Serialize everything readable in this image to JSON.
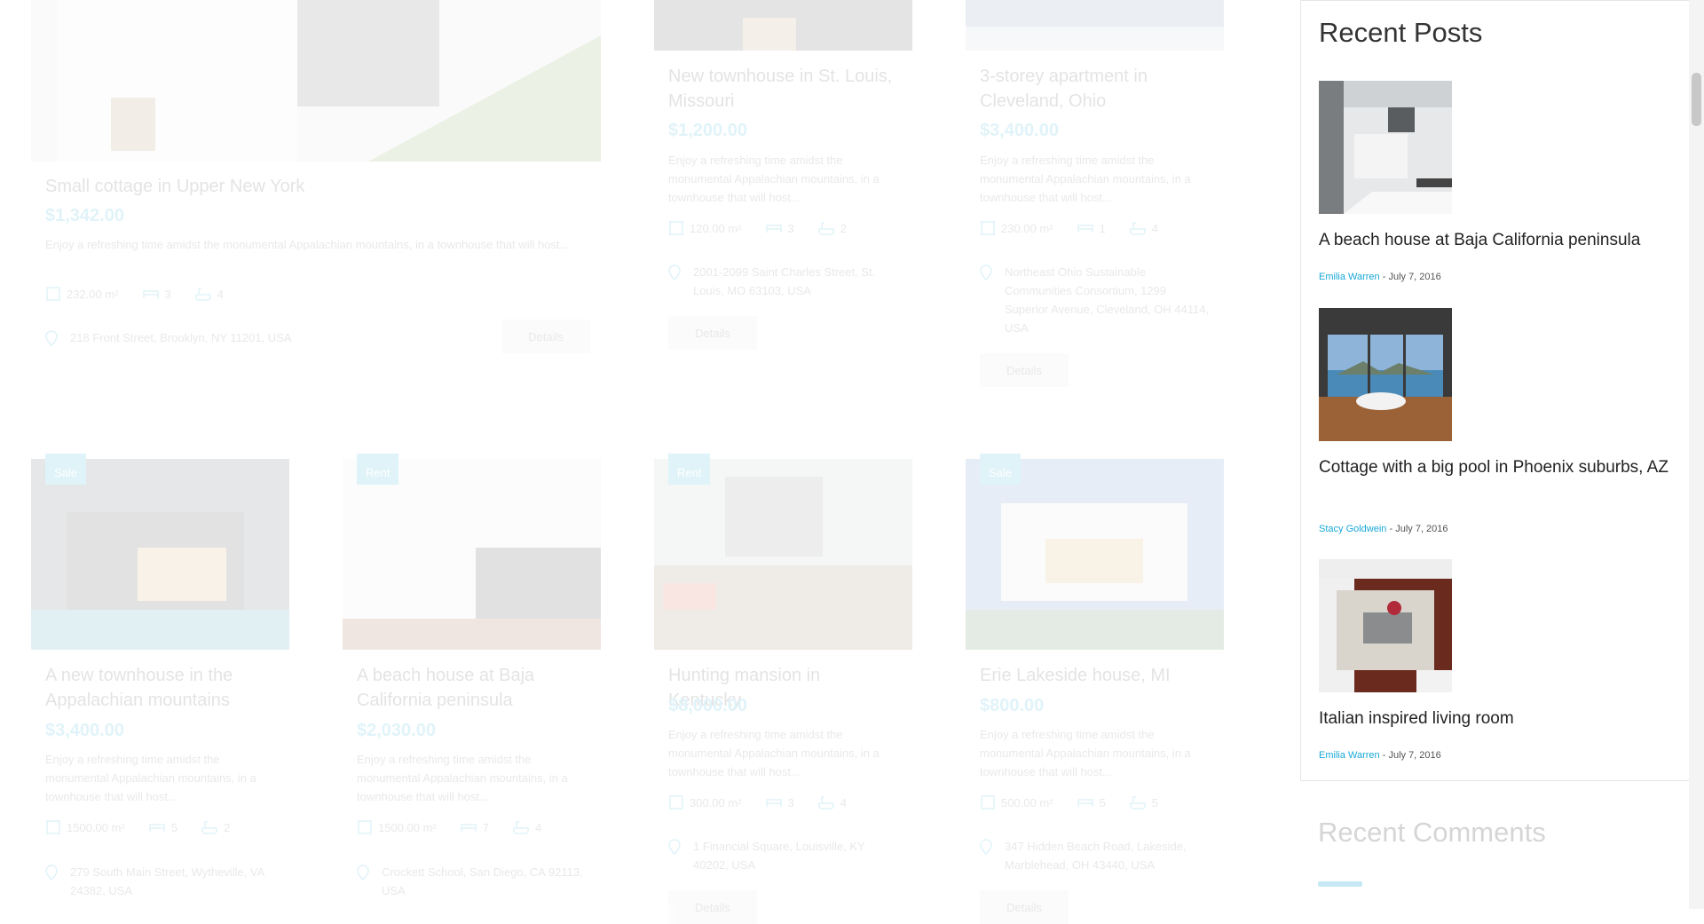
{
  "colors": {
    "accent": "#1aa8d6",
    "text": "#333333",
    "muted": "#555555"
  },
  "listings_top": [
    {
      "title": "Small cottage in Upper New York",
      "price": "$1,342.00",
      "excerpt": "Enjoy a refreshing time amidst the monumental Appalachian mountains, in a townhouse that will host...",
      "area": "232.00 m²",
      "beds": "3",
      "baths": "4",
      "address": "218 Front Street, Brooklyn, NY 11201, USA",
      "details": "Details"
    },
    {
      "title": "New townhouse in St. Louis, Missouri",
      "price": "$1,200.00",
      "excerpt": "Enjoy a refreshing time amidst the monumental Appalachian mountains, in a townhouse that will host...",
      "area": "120.00 m²",
      "beds": "3",
      "baths": "2",
      "address": "2001-2099 Saint Charles Street, St. Louis, MO 63103, USA",
      "details": "Details"
    },
    {
      "title": "3-storey apartment in Cleveland, Ohio",
      "price": "$3,400.00",
      "excerpt": "Enjoy a refreshing time amidst the monumental Appalachian mountains, in a townhouse that will host...",
      "area": "230.00 m²",
      "beds": "1",
      "baths": "4",
      "address": "Northeast Ohio Sustainable Communities Consortium, 1299 Superior Avenue, Cleveland, OH 44114, USA",
      "details": "Details"
    }
  ],
  "listings_bottom": [
    {
      "badge": "Sale",
      "title": "A new townhouse in the Appalachian mountains",
      "price": "$3,400.00",
      "excerpt": "Enjoy a refreshing time amidst the monumental Appalachian mountains, in a townhouse that will host...",
      "area": "1500.00 m²",
      "beds": "5",
      "baths": "2",
      "address": "279 South Main Street, Wytheville, VA 24382, USA"
    },
    {
      "badge": "Rent",
      "title": "A beach house at Baja California peninsula",
      "price": "$2,030.00",
      "excerpt": "Enjoy a refreshing time amidst the monumental Appalachian mountains, in a townhouse that will host...",
      "area": "1500.00 m²",
      "beds": "7",
      "baths": "4",
      "address": "Crockett School, San Diego, CA 92113, USA"
    },
    {
      "badge": "Rent",
      "title": "Hunting mansion in Kentucky",
      "price": "$8,000.00",
      "excerpt": "Enjoy a refreshing time amidst the monumental Appalachian mountains, in a townhouse that will host...",
      "area": "300.00 m²",
      "beds": "3",
      "baths": "4",
      "address": "1 Financial Square, Louisville, KY 40202, USA",
      "details": "Details"
    },
    {
      "badge": "Sale",
      "title": "Erie Lakeside house, MI",
      "price": "$800.00",
      "excerpt": "Enjoy a refreshing time amidst the monumental Appalachian mountains, in a townhouse that will host...",
      "area": "500.00 m²",
      "beds": "5",
      "baths": "5",
      "address": "347 Hidden Beach Road, Lakeside, Marblehead, OH 43440, USA",
      "details": "Details"
    }
  ],
  "sidebar": {
    "recent_posts_title": "Recent Posts",
    "posts": [
      {
        "title": "A beach house at Baja California peninsula",
        "author": "Emilia Warren",
        "date": " - July 7, 2016"
      },
      {
        "title": "Cottage with a big pool in Phoenix suburbs, AZ",
        "author": "Stacy Goldwein",
        "date": " - July 7, 2016"
      },
      {
        "title": "Italian inspired living room",
        "author": "Emilia Warren",
        "date": " - July 7, 2016"
      }
    ],
    "recent_comments_title": "Recent Comments"
  }
}
